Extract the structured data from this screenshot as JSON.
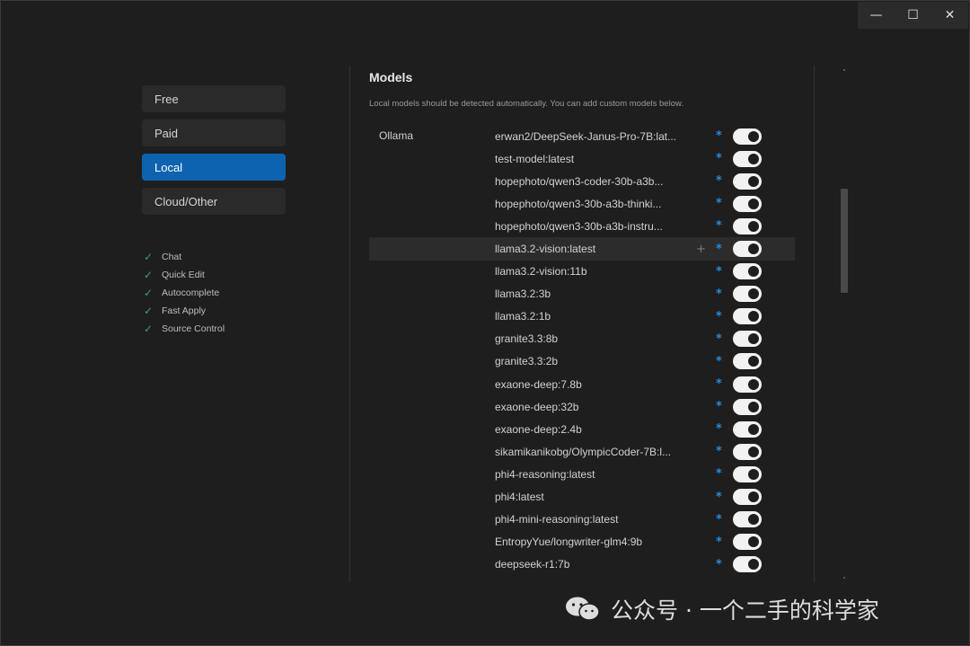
{
  "window": {
    "controls": {
      "minimize": "—",
      "maximize": "☐",
      "close": "✕"
    }
  },
  "sidebar": {
    "items": [
      {
        "label": "Free",
        "active": false
      },
      {
        "label": "Paid",
        "active": false
      },
      {
        "label": "Local",
        "active": true
      },
      {
        "label": "Cloud/Other",
        "active": false
      }
    ],
    "features": [
      "Chat",
      "Quick Edit",
      "Autocomplete",
      "Fast Apply",
      "Source Control"
    ]
  },
  "main": {
    "title": "Models",
    "description": "Local models should be detected automatically. You can add custom models below.",
    "provider": "Ollama",
    "models": [
      {
        "name": "erwan2/DeepSeek-Janus-Pro-7B:lat...",
        "enabled": true
      },
      {
        "name": "test-model:latest",
        "enabled": true
      },
      {
        "name": "hopephoto/qwen3-coder-30b-a3b...",
        "enabled": true
      },
      {
        "name": "hopephoto/qwen3-30b-a3b-thinki...",
        "enabled": true
      },
      {
        "name": "hopephoto/qwen3-30b-a3b-instru...",
        "enabled": true
      },
      {
        "name": "llama3.2-vision:latest",
        "enabled": true,
        "hovered": true
      },
      {
        "name": "llama3.2-vision:11b",
        "enabled": true
      },
      {
        "name": "llama3.2:3b",
        "enabled": true
      },
      {
        "name": "llama3.2:1b",
        "enabled": true
      },
      {
        "name": "granite3.3:8b",
        "enabled": true
      },
      {
        "name": "granite3.3:2b",
        "enabled": true
      },
      {
        "name": "exaone-deep:7.8b",
        "enabled": true
      },
      {
        "name": "exaone-deep:32b",
        "enabled": true
      },
      {
        "name": "exaone-deep:2.4b",
        "enabled": true
      },
      {
        "name": "sikamikanikobg/OlympicCoder-7B:l...",
        "enabled": true
      },
      {
        "name": "phi4-reasoning:latest",
        "enabled": true
      },
      {
        "name": "phi4:latest",
        "enabled": true
      },
      {
        "name": "phi4-mini-reasoning:latest",
        "enabled": true
      },
      {
        "name": "EntropyYue/longwriter-glm4:9b",
        "enabled": true
      },
      {
        "name": "deepseek-r1:7b",
        "enabled": true
      }
    ],
    "row_plus": "+",
    "row_asterisk": "*"
  },
  "watermark": {
    "text": "公众号 · 一个二手的科学家"
  },
  "colors": {
    "accent": "#0e63b0",
    "check": "#2fa86a",
    "asterisk": "#2a8ad8"
  }
}
